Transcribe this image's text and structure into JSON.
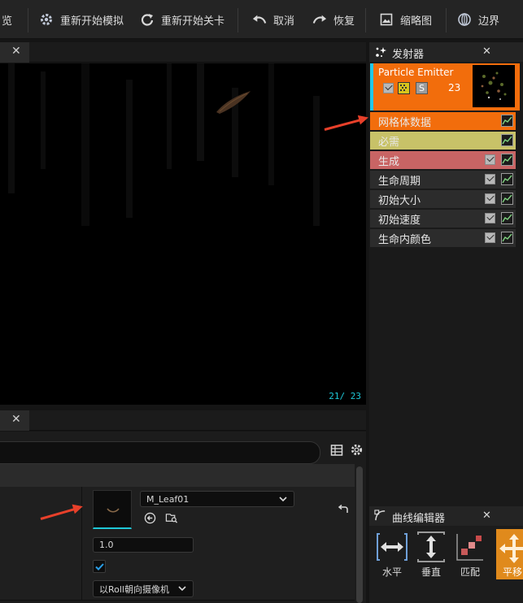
{
  "toolbar": {
    "partial_label": "览",
    "restart_sim_label": "重新开始模拟",
    "restart_level_label": "重新开始关卡",
    "undo_label": "取消",
    "redo_label": "恢复",
    "thumbnail_label": "缩略图",
    "bounds_label": "边界"
  },
  "viewport": {
    "frame_counter": "21/ 23"
  },
  "emitter_panel": {
    "title": "发射器",
    "emitter": {
      "name": "Particle Emitter",
      "solo_label": "S",
      "count": "23",
      "color": "#f26d0c"
    },
    "modules": [
      {
        "label": "网格体数据",
        "bg": "#f26d0c",
        "has_checkbox": false
      },
      {
        "label": "必需",
        "bg": "#c8c268",
        "has_checkbox": false
      },
      {
        "label": "生成",
        "bg": "#c86464",
        "has_checkbox": true
      },
      {
        "label": "生命周期",
        "bg": "#2c2c2c",
        "has_checkbox": true
      },
      {
        "label": "初始大小",
        "bg": "#2c2c2c",
        "has_checkbox": true
      },
      {
        "label": "初始速度",
        "bg": "#2c2c2c",
        "has_checkbox": true
      },
      {
        "label": "生命内颜色",
        "bg": "#2c2c2c",
        "has_checkbox": true
      }
    ]
  },
  "details": {
    "material": {
      "value": "M_Leaf01"
    },
    "value_field": "1.0",
    "screen_alignment": "以Roll朝向摄像机"
  },
  "curve_editor": {
    "title": "曲线编辑器",
    "buttons": [
      {
        "label": "水平"
      },
      {
        "label": "垂直"
      },
      {
        "label": "匹配"
      },
      {
        "label": "平移"
      }
    ]
  },
  "colors": {
    "accent_orange": "#f26d0c",
    "annotation_arrow": "#e8402a",
    "selection_cyan": "#20c8e8"
  }
}
